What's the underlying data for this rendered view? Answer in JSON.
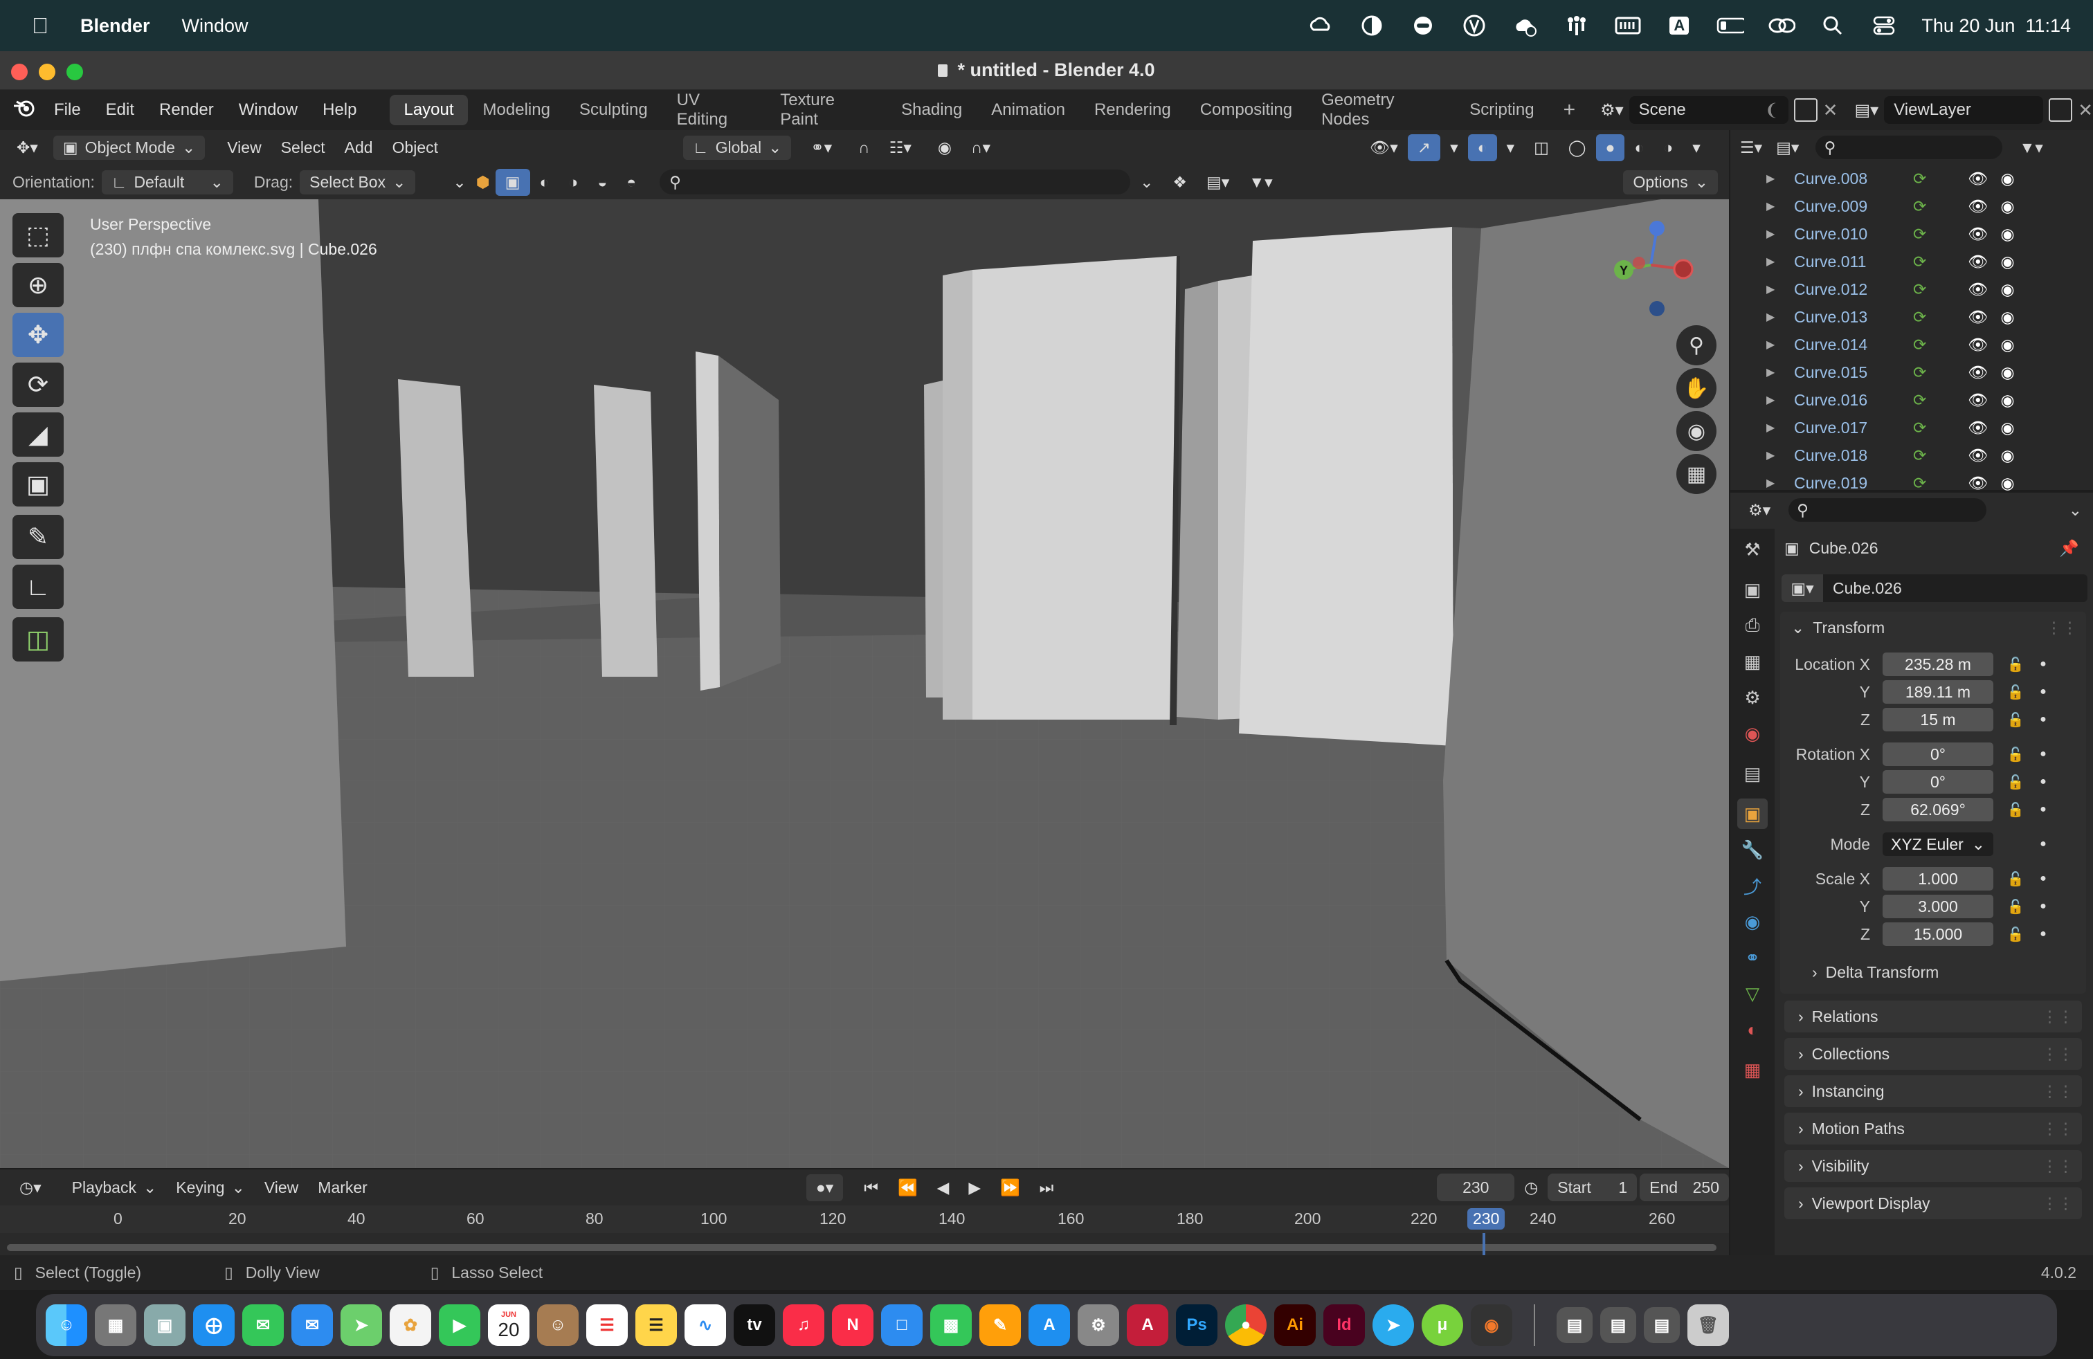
{
  "menubar": {
    "apple": "",
    "app_name": "Blender",
    "items": [
      "Window"
    ],
    "status_icons": [
      "creative-cloud-icon",
      "halfmoon-icon",
      "game-controller-icon",
      "vpn-icon",
      "upload-icon",
      "fan-icon",
      "memory-icon",
      "input-source-icon",
      "battery-icon",
      "screen-mirroring-icon",
      "search-icon",
      "control-center-icon"
    ],
    "input_source": "A",
    "datetime": "Thu 20 Jun  11:14"
  },
  "window": {
    "title": "* untitled - Blender 4.0"
  },
  "topbar": {
    "menus": [
      "File",
      "Edit",
      "Render",
      "Window",
      "Help"
    ],
    "workspaces": [
      "Layout",
      "Modeling",
      "Sculpting",
      "UV Editing",
      "Texture Paint",
      "Shading",
      "Animation",
      "Rendering",
      "Compositing",
      "Geometry Nodes",
      "Scripting"
    ],
    "active_workspace": "Layout",
    "add_workspace": "+",
    "scene_label": "Scene",
    "viewlayer_label": "ViewLayer"
  },
  "viewport": {
    "mode": "Object Mode",
    "menus": [
      "View",
      "Select",
      "Add",
      "Object"
    ],
    "transform_orientation": "Global",
    "orientation_label": "Orientation:",
    "orientation_value": "Default",
    "drag_label": "Drag:",
    "drag_value": "Select Box",
    "options_label": "Options",
    "overlay_line1": "User Perspective",
    "overlay_line2": "(230) плфн спа комлекс.svg | Cube.026",
    "gizmo_labels": {
      "y": "Y"
    },
    "tools": [
      "select-box-icon",
      "cursor-icon",
      "move-icon",
      "rotate-icon",
      "scale-icon",
      "transform-icon",
      "annotate-icon",
      "measure-icon",
      "add-cube-icon"
    ],
    "active_tool": "move-icon"
  },
  "timeline": {
    "menus": [
      "Playback",
      "Keying",
      "View",
      "Marker"
    ],
    "current_frame": "230",
    "start_label": "Start",
    "start_value": "1",
    "end_label": "End",
    "end_value": "250",
    "ticks": [
      "0",
      "20",
      "40",
      "60",
      "80",
      "100",
      "120",
      "140",
      "160",
      "180",
      "200",
      "220",
      "230",
      "240",
      "260"
    ]
  },
  "statusbar": {
    "hint1": "Select (Toggle)",
    "hint2": "Dolly View",
    "hint3": "Lasso Select",
    "version": "4.0.2"
  },
  "outliner": {
    "items": [
      "Curve.008",
      "Curve.009",
      "Curve.010",
      "Curve.011",
      "Curve.012",
      "Curve.013",
      "Curve.014",
      "Curve.015",
      "Curve.016",
      "Curve.017",
      "Curve.018",
      "Curve.019"
    ]
  },
  "properties": {
    "object_name": "Cube.026",
    "datablock_name": "Cube.026",
    "transform_label": "Transform",
    "location": {
      "label": "Location X",
      "x": "235.28 m",
      "y": "189.11 m",
      "z": "15 m"
    },
    "rotation": {
      "label": "Rotation X",
      "x": "0°",
      "y": "0°",
      "z": "62.069°"
    },
    "mode_label": "Mode",
    "mode_value": "XYZ Euler",
    "scale": {
      "label": "Scale X",
      "x": "1.000",
      "y": "3.000",
      "z": "15.000"
    },
    "axis_y": "Y",
    "axis_z": "Z",
    "delta_transform": "Delta Transform",
    "panels": [
      "Relations",
      "Collections",
      "Instancing",
      "Motion Paths",
      "Visibility",
      "Viewport Display"
    ]
  },
  "dock": {
    "apps": [
      "finder-icon",
      "launchpad-icon",
      "preview-icon",
      "safari-icon",
      "messages-icon",
      "mail-icon",
      "maps-icon",
      "photos-icon",
      "facetime-icon",
      "calendar-icon",
      "contacts-icon",
      "reminders-icon",
      "notes-icon",
      "freeform-icon",
      "tv-icon",
      "music-icon",
      "news-icon",
      "keynote-icon",
      "numbers-icon",
      "pages-icon",
      "app-store-icon",
      "system-settings-icon",
      "autocad-icon",
      "photoshop-icon",
      "chrome-icon",
      "illustrator-icon",
      "indesign-icon",
      "telegram-icon",
      "utorrent-icon",
      "blender-icon"
    ],
    "calendar_month": "JUN",
    "calendar_day": "20",
    "ps_label": "Ps",
    "ai_label": "Ai",
    "id_label": "Id",
    "tv_label": "tv"
  },
  "colors": {
    "accent": "#4872b2",
    "menubar_bg": "#1a3135",
    "floor": "#606060",
    "outliner_text": "#9bc0e8"
  }
}
